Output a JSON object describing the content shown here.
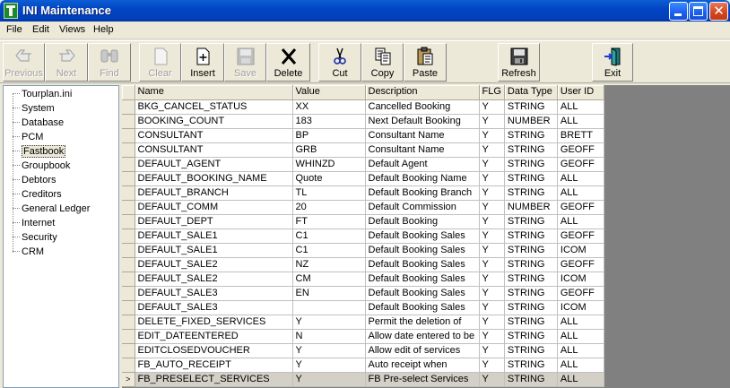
{
  "window": {
    "title": "INI Maintenance"
  },
  "menu": [
    "File",
    "Edit",
    "Views",
    "Help"
  ],
  "toolbar": {
    "previous": "Previous",
    "next": "Next",
    "find": "Find",
    "clear": "Clear",
    "insert": "Insert",
    "save": "Save",
    "delete": "Delete",
    "cut": "Cut",
    "copy": "Copy",
    "paste": "Paste",
    "refresh": "Refresh",
    "exit": "Exit"
  },
  "tree": {
    "root": "Tourplan.ini",
    "items": [
      "System",
      "Database",
      "PCM",
      "Fastbook",
      "Groupbook",
      "Debtors",
      "Creditors",
      "General Ledger",
      "Internet",
      "Security",
      "CRM"
    ],
    "selected": "Fastbook"
  },
  "grid": {
    "columns": [
      "Name",
      "Value",
      "Description",
      "FLG",
      "Data Type",
      "User ID"
    ],
    "rows": [
      [
        "BKG_CANCEL_STATUS",
        "XX",
        "Cancelled Booking",
        "Y",
        "STRING",
        "ALL"
      ],
      [
        "BOOKING_COUNT",
        "183",
        "Next Default Booking",
        "Y",
        "NUMBER",
        "ALL"
      ],
      [
        "CONSULTANT",
        "BP",
        "Consultant Name",
        "Y",
        "STRING",
        "BRETT"
      ],
      [
        "CONSULTANT",
        "GRB",
        "Consultant Name",
        "Y",
        "STRING",
        "GEOFF"
      ],
      [
        "DEFAULT_AGENT",
        "WHINZD",
        "Default Agent",
        "Y",
        "STRING",
        "GEOFF"
      ],
      [
        "DEFAULT_BOOKING_NAME",
        "Quote",
        "Default Booking Name",
        "Y",
        "STRING",
        "ALL"
      ],
      [
        "DEFAULT_BRANCH",
        "TL",
        "Default Booking Branch",
        "Y",
        "STRING",
        "ALL"
      ],
      [
        "DEFAULT_COMM",
        "20",
        "Default Commission",
        "Y",
        "NUMBER",
        "GEOFF"
      ],
      [
        "DEFAULT_DEPT",
        "FT",
        "Default Booking",
        "Y",
        "STRING",
        "ALL"
      ],
      [
        "DEFAULT_SALE1",
        "C1",
        "Default Booking Sales",
        "Y",
        "STRING",
        "GEOFF"
      ],
      [
        "DEFAULT_SALE1",
        "C1",
        "Default Booking Sales",
        "Y",
        "STRING",
        "ICOM"
      ],
      [
        "DEFAULT_SALE2",
        "NZ",
        "Default Booking Sales",
        "Y",
        "STRING",
        "GEOFF"
      ],
      [
        "DEFAULT_SALE2",
        "CM",
        "Default Booking Sales",
        "Y",
        "STRING",
        "ICOM"
      ],
      [
        "DEFAULT_SALE3",
        "EN",
        "Default Booking Sales",
        "Y",
        "STRING",
        "GEOFF"
      ],
      [
        "DEFAULT_SALE3",
        "",
        "Default Booking Sales",
        "Y",
        "STRING",
        "ICOM"
      ],
      [
        "DELETE_FIXED_SERVICES",
        "Y",
        "Permit the deletion of",
        "Y",
        "STRING",
        "ALL"
      ],
      [
        "EDIT_DATEENTERED",
        "N",
        "Allow date entered to be",
        "Y",
        "STRING",
        "ALL"
      ],
      [
        "EDITCLOSEDVOUCHER",
        "Y",
        "Allow edit of services",
        "Y",
        "STRING",
        "ALL"
      ],
      [
        "FB_AUTO_RECEIPT",
        "Y",
        "Auto receipt when",
        "Y",
        "STRING",
        "ALL"
      ],
      [
        "FB_PRESELECT_SERVICES",
        "Y",
        "FB Pre-select Services",
        "Y",
        "STRING",
        "ALL"
      ]
    ],
    "current_row": 19,
    "current_marker": ">"
  }
}
